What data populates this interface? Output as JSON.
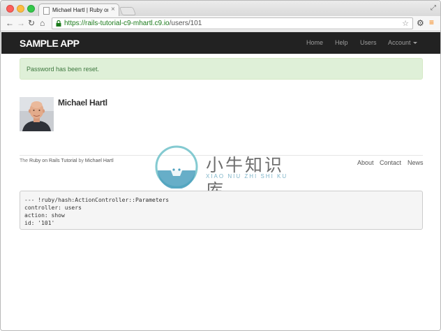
{
  "browser": {
    "tab_title": "Michael Hartl | Ruby on Rails",
    "tab_close": "×",
    "url_host": "https://rails-tutorial-c9-mhartl.c9.io",
    "url_path": "/users/101"
  },
  "navbar": {
    "logo": "SAMPLE APP",
    "links": [
      "Home",
      "Help",
      "Users",
      "Account"
    ]
  },
  "alert": {
    "message": "Password has been reset."
  },
  "profile": {
    "name": "Michael Hartl"
  },
  "footer": {
    "prefix": "The ",
    "tutorial_link": "Ruby on Rails Tutorial",
    "middle": " by ",
    "author_link": "Michael Hartl",
    "links": [
      "About",
      "Contact",
      "News"
    ]
  },
  "watermark": {
    "title": "小牛知识库",
    "subtitle": "XIAO NIU ZHI SHI KU"
  },
  "debug": {
    "lines": [
      "--- !ruby/hash:ActionController::Parameters",
      "controller: users",
      "action: show",
      "id: '101'"
    ]
  },
  "colors": {
    "navbar_bg": "#222222",
    "alert_bg": "#dff0d8",
    "alert_text": "#3c763d",
    "url_secure": "#1a7a1a"
  }
}
